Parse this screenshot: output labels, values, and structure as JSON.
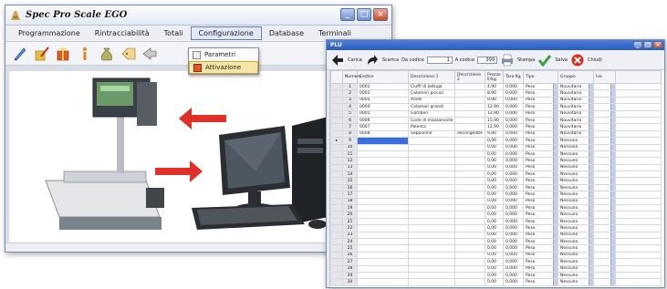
{
  "main_window": {
    "title": "Spec Pro Scale EGO",
    "menu": [
      "Programmazione",
      "Rintracciabilità",
      "Totali",
      "Configurazione",
      "Database",
      "Terminali"
    ],
    "active_menu": "Configurazione",
    "dropdown": [
      "Parametri",
      "Attivazione"
    ],
    "selected_dropdown": "Attivazione",
    "colors": {
      "arrow": "#e0302a",
      "dropdown_highlight": "#f6e6a8",
      "titlebar": "#e4e9f3"
    }
  },
  "plu_window": {
    "title": "PLU",
    "toolbar": {
      "back_label": "Carica",
      "forward_label": "Scarica",
      "from_code_label": "Da codice",
      "from_code_value": "1",
      "to_code_label": "A codice",
      "to_code_value": "999",
      "print_label": "Stampa",
      "save_label": "Salva",
      "close_label": "Chiudi"
    },
    "columns": [
      "Numero",
      "Codice",
      "Descrizione 1",
      "Descrizione 2",
      "Prezzo €/kg",
      "Tara Kg",
      "Tipo",
      "Gruppo",
      "Iva"
    ],
    "rows": [
      {
        "num": "1",
        "code": "0001",
        "desc1": "Ciuffi di lattuga",
        "desc2": "",
        "price": "4,90",
        "tare": "0,000",
        "type": "Peso",
        "group": "Nouvitario",
        "iva": ""
      },
      {
        "num": "2",
        "code": "0002",
        "desc1": "Calamari piccoli",
        "desc2": "",
        "price": "8,90",
        "tare": "0,000",
        "type": "Peso",
        "group": "Nouvitario",
        "iva": ""
      },
      {
        "num": "3",
        "code": "0003",
        "desc1": "Anelli",
        "desc2": "",
        "price": "9,90",
        "tare": "0,000",
        "type": "Peso",
        "group": "Nouvitario",
        "iva": ""
      },
      {
        "num": "4",
        "code": "0004",
        "desc1": "Calamari grandi",
        "desc2": "",
        "price": "12,90",
        "tare": "0,000",
        "type": "Peso",
        "group": "Nouvitario",
        "iva": ""
      },
      {
        "num": "5",
        "code": "0005",
        "desc1": "Gamberi",
        "desc2": "",
        "price": "12,90",
        "tare": "0,000",
        "type": "Peso",
        "group": "Nouvitario",
        "iva": ""
      },
      {
        "num": "6",
        "code": "0006",
        "desc1": "Code di mazzancolle",
        "desc2": "",
        "price": "15,90",
        "tare": "0,000",
        "type": "Peso",
        "group": "Nouvitario",
        "iva": ""
      },
      {
        "num": "7",
        "code": "0007",
        "desc1": "Polenta",
        "desc2": "",
        "price": "12,90",
        "tare": "0,000",
        "type": "Peso",
        "group": "Nouvitario",
        "iva": ""
      },
      {
        "num": "8",
        "code": "0008",
        "desc1": "Seppioline",
        "desc2": "decongelate",
        "price": "9,90",
        "tare": "0,000",
        "type": "Peso",
        "group": "Nouvitario",
        "iva": ""
      },
      {
        "num": "9",
        "code": "",
        "desc1": "",
        "desc2": "",
        "price": "0,00",
        "tare": "0,000",
        "type": "Peso",
        "group": "Nessuno",
        "iva": ""
      },
      {
        "num": "10",
        "code": "",
        "desc1": "",
        "desc2": "",
        "price": "0,00",
        "tare": "0,000",
        "type": "Peso",
        "group": "Nessuno",
        "iva": ""
      },
      {
        "num": "11",
        "code": "",
        "desc1": "",
        "desc2": "",
        "price": "0,00",
        "tare": "0,000",
        "type": "Peso",
        "group": "Nessuno",
        "iva": ""
      },
      {
        "num": "12",
        "code": "",
        "desc1": "",
        "desc2": "",
        "price": "0,00",
        "tare": "0,000",
        "type": "Peso",
        "group": "Nessuno",
        "iva": ""
      },
      {
        "num": "13",
        "code": "",
        "desc1": "",
        "desc2": "",
        "price": "0,00",
        "tare": "0,000",
        "type": "Peso",
        "group": "Nessuno",
        "iva": ""
      },
      {
        "num": "14",
        "code": "",
        "desc1": "",
        "desc2": "",
        "price": "0,00",
        "tare": "0,000",
        "type": "Peso",
        "group": "Nessuno",
        "iva": ""
      },
      {
        "num": "15",
        "code": "",
        "desc1": "",
        "desc2": "",
        "price": "0,00",
        "tare": "0,000",
        "type": "Peso",
        "group": "Nessuno",
        "iva": ""
      },
      {
        "num": "16",
        "code": "",
        "desc1": "",
        "desc2": "",
        "price": "0,00",
        "tare": "0,000",
        "type": "Peso",
        "group": "Nessuno",
        "iva": ""
      },
      {
        "num": "17",
        "code": "",
        "desc1": "",
        "desc2": "",
        "price": "0,00",
        "tare": "0,000",
        "type": "Peso",
        "group": "Nessuno",
        "iva": ""
      },
      {
        "num": "18",
        "code": "",
        "desc1": "",
        "desc2": "",
        "price": "0,00",
        "tare": "0,000",
        "type": "Peso",
        "group": "Nessuno",
        "iva": ""
      },
      {
        "num": "19",
        "code": "",
        "desc1": "",
        "desc2": "",
        "price": "0,00",
        "tare": "0,000",
        "type": "Peso",
        "group": "Nessuno",
        "iva": ""
      },
      {
        "num": "20",
        "code": "",
        "desc1": "",
        "desc2": "",
        "price": "0,00",
        "tare": "0,000",
        "type": "Peso",
        "group": "Nessuno",
        "iva": ""
      },
      {
        "num": "21",
        "code": "",
        "desc1": "",
        "desc2": "",
        "price": "0,00",
        "tare": "0,000",
        "type": "Peso",
        "group": "Nessuno",
        "iva": ""
      },
      {
        "num": "22",
        "code": "",
        "desc1": "",
        "desc2": "",
        "price": "0,00",
        "tare": "0,000",
        "type": "Peso",
        "group": "Nessuno",
        "iva": ""
      },
      {
        "num": "23",
        "code": "",
        "desc1": "",
        "desc2": "",
        "price": "0,00",
        "tare": "0,000",
        "type": "Peso",
        "group": "Nessuno",
        "iva": ""
      },
      {
        "num": "24",
        "code": "",
        "desc1": "",
        "desc2": "",
        "price": "0,00",
        "tare": "0,000",
        "type": "Peso",
        "group": "Nessuno",
        "iva": ""
      },
      {
        "num": "25",
        "code": "",
        "desc1": "",
        "desc2": "",
        "price": "0,00",
        "tare": "0,000",
        "type": "Peso",
        "group": "Nessuno",
        "iva": ""
      },
      {
        "num": "26",
        "code": "",
        "desc1": "",
        "desc2": "",
        "price": "0,00",
        "tare": "0,000",
        "type": "Peso",
        "group": "Nessuno",
        "iva": ""
      },
      {
        "num": "27",
        "code": "",
        "desc1": "",
        "desc2": "",
        "price": "0,00",
        "tare": "0,000",
        "type": "Peso",
        "group": "Nessuno",
        "iva": ""
      },
      {
        "num": "28",
        "code": "",
        "desc1": "",
        "desc2": "",
        "price": "0,00",
        "tare": "0,000",
        "type": "Peso",
        "group": "Nessuno",
        "iva": ""
      },
      {
        "num": "29",
        "code": "",
        "desc1": "",
        "desc2": "",
        "price": "0,00",
        "tare": "0,000",
        "type": "Peso",
        "group": "Nessuno",
        "iva": ""
      },
      {
        "num": "30",
        "code": "",
        "desc1": "",
        "desc2": "",
        "price": "0,00",
        "tare": "0,000",
        "type": "Peso",
        "group": "Nessuno",
        "iva": ""
      }
    ],
    "selected_row": "9"
  }
}
